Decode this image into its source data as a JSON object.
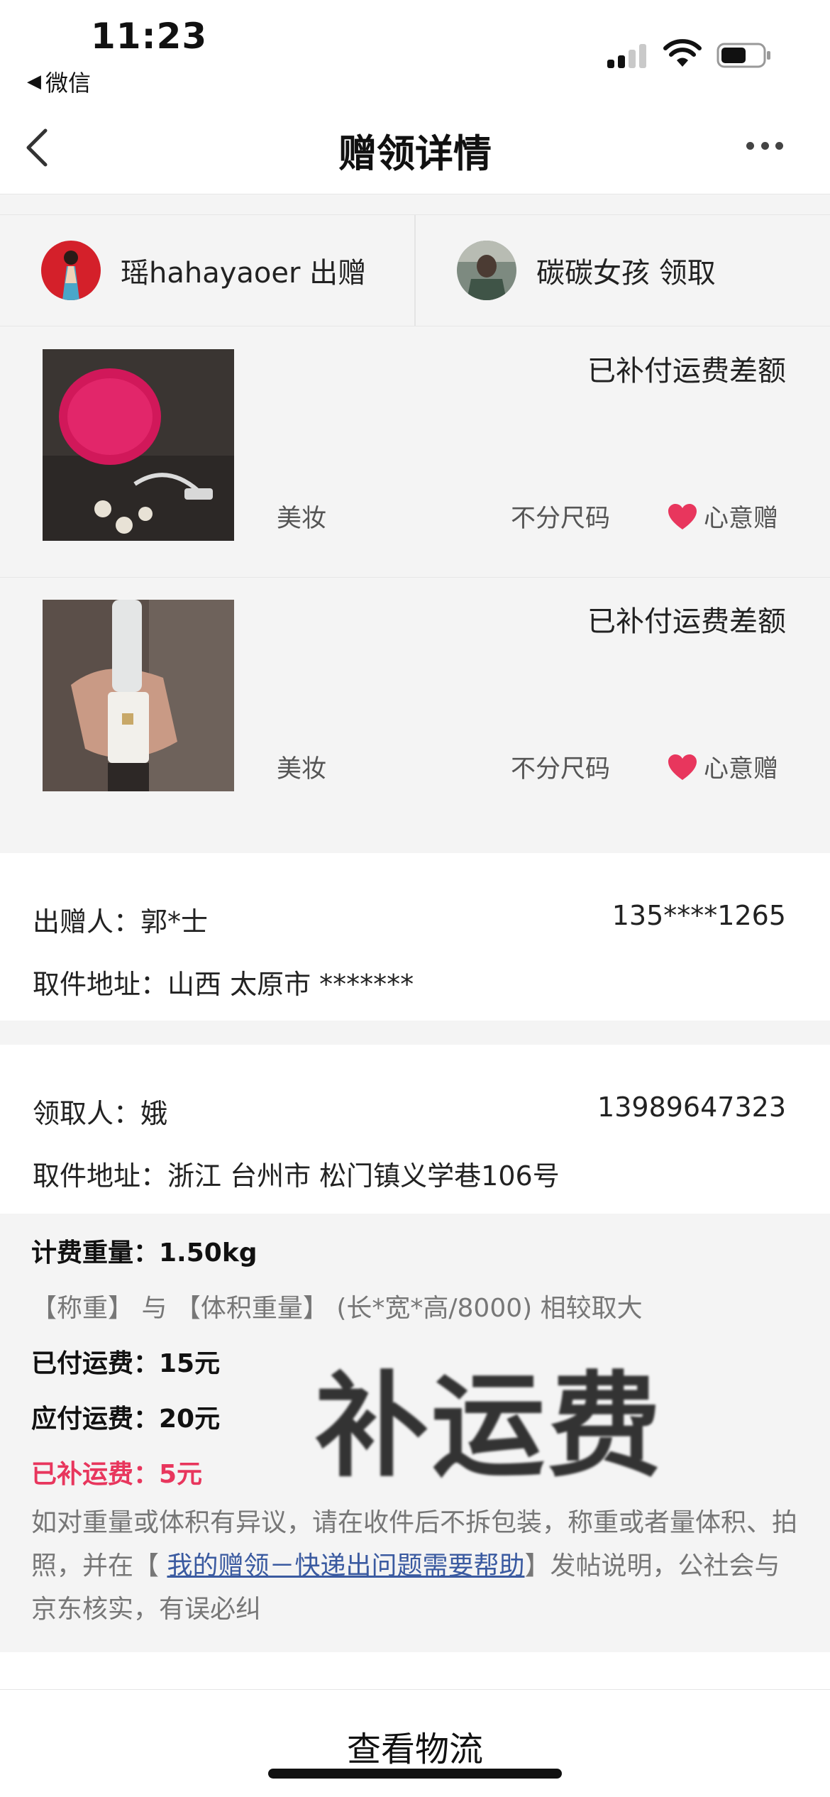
{
  "status_bar": {
    "time": "11:23",
    "back_app_label": "微信",
    "back_app_icon": "left-triangle-icon",
    "signal_icon": "cellular-signal-icon",
    "wifi_icon": "wifi-icon",
    "battery_icon": "battery-icon",
    "battery_level": 0.55
  },
  "nav": {
    "title": "赠领详情",
    "back_icon": "chevron-left-icon",
    "more_icon": "ellipsis-icon"
  },
  "parties": {
    "giver": {
      "name": "瑶hahayaoer 出赠",
      "avatar_icon": "avatar-giver"
    },
    "receiver": {
      "name": "碳碳女孩 领取",
      "avatar_icon": "avatar-receiver"
    }
  },
  "items": [
    {
      "status": "已补付运费差额",
      "category": "美妆",
      "size": "不分尺码",
      "gift_type": "心意赠",
      "gift_icon": "heart-icon"
    },
    {
      "status": "已补付运费差额",
      "category": "美妆",
      "size": "不分尺码",
      "gift_type": "心意赠",
      "gift_icon": "heart-icon"
    }
  ],
  "sender": {
    "name_label": "出赠人：郭*士",
    "phone": "135****1265",
    "address": "取件地址：山西 太原市 *******"
  },
  "receiver": {
    "name_label": "领取人：娥",
    "phone": "13989647323",
    "address": "取件地址：浙江 台州市 松门镇义学巷106号"
  },
  "fee": {
    "weight": "计费重量：1.50kg",
    "rule": "【称重】 与 【体积重量】 (长*宽*高/8000) 相较取大",
    "paid": "已付运费：15元",
    "due": "应付运费：20元",
    "supplemented": "已补运费：5元",
    "stamp": "补运费",
    "notice_before": "如对重量或体积有异议，请在收件后不拆包装，称重或者量体积、拍照，并在【 ",
    "notice_link": "我的赠领－快递出问题需要帮助",
    "notice_after": "】发帖说明，公社会与京东核实，有误必纠"
  },
  "actions": {
    "logistics": "查看物流"
  },
  "colors": {
    "accent_red": "#e8365d",
    "link_blue": "#3a5aa0",
    "gray_bg": "#f4f4f4"
  }
}
